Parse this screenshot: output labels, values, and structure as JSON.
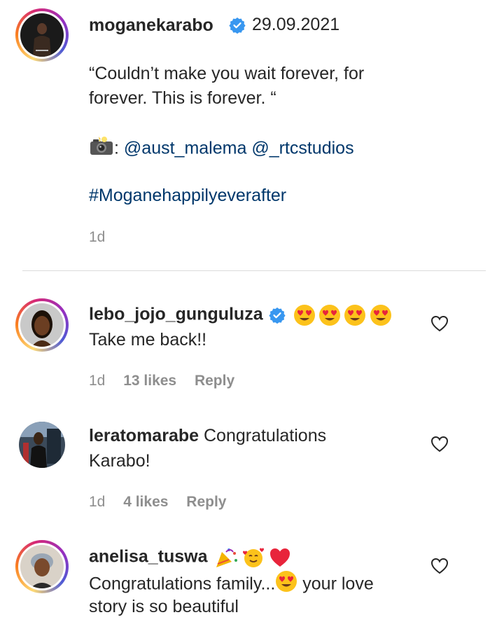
{
  "post": {
    "username": "moganekarabo",
    "date": "29.09.2021",
    "caption_line1": "“Couldn’t make you wait forever, for",
    "caption_line2": "forever. This is forever. “",
    "credit_prefix": ":",
    "mention1": "@aust_malema",
    "mention2": "@_rtcstudios",
    "hashtag": "#Moganehappilyeverafter",
    "age": "1d"
  },
  "comments": [
    {
      "username": "lebo_jojo_gunguluza",
      "text": "Take me back!!",
      "age": "1d",
      "likes": "13 likes",
      "reply": "Reply"
    },
    {
      "username": "leratomarabe",
      "text_line1": "Congratulations",
      "text_line2": "Karabo!",
      "age": "1d",
      "likes": "4 likes",
      "reply": "Reply"
    },
    {
      "username": "anelisa_tuswa",
      "text_line1a": "Congratulations family...",
      "text_line1b": "your love",
      "text_line2": "story is so beautiful"
    }
  ],
  "colors": {
    "verified_blue": "#3897f0",
    "link_blue": "#00376b",
    "meta_gray": "#8e8e8e"
  },
  "icons": [
    "verified-badge-icon",
    "camera-flash-emoji",
    "heart-eyes-emoji",
    "party-popper-emoji",
    "smiling-hearts-emoji",
    "red-heart-emoji",
    "like-heart-icon"
  ]
}
